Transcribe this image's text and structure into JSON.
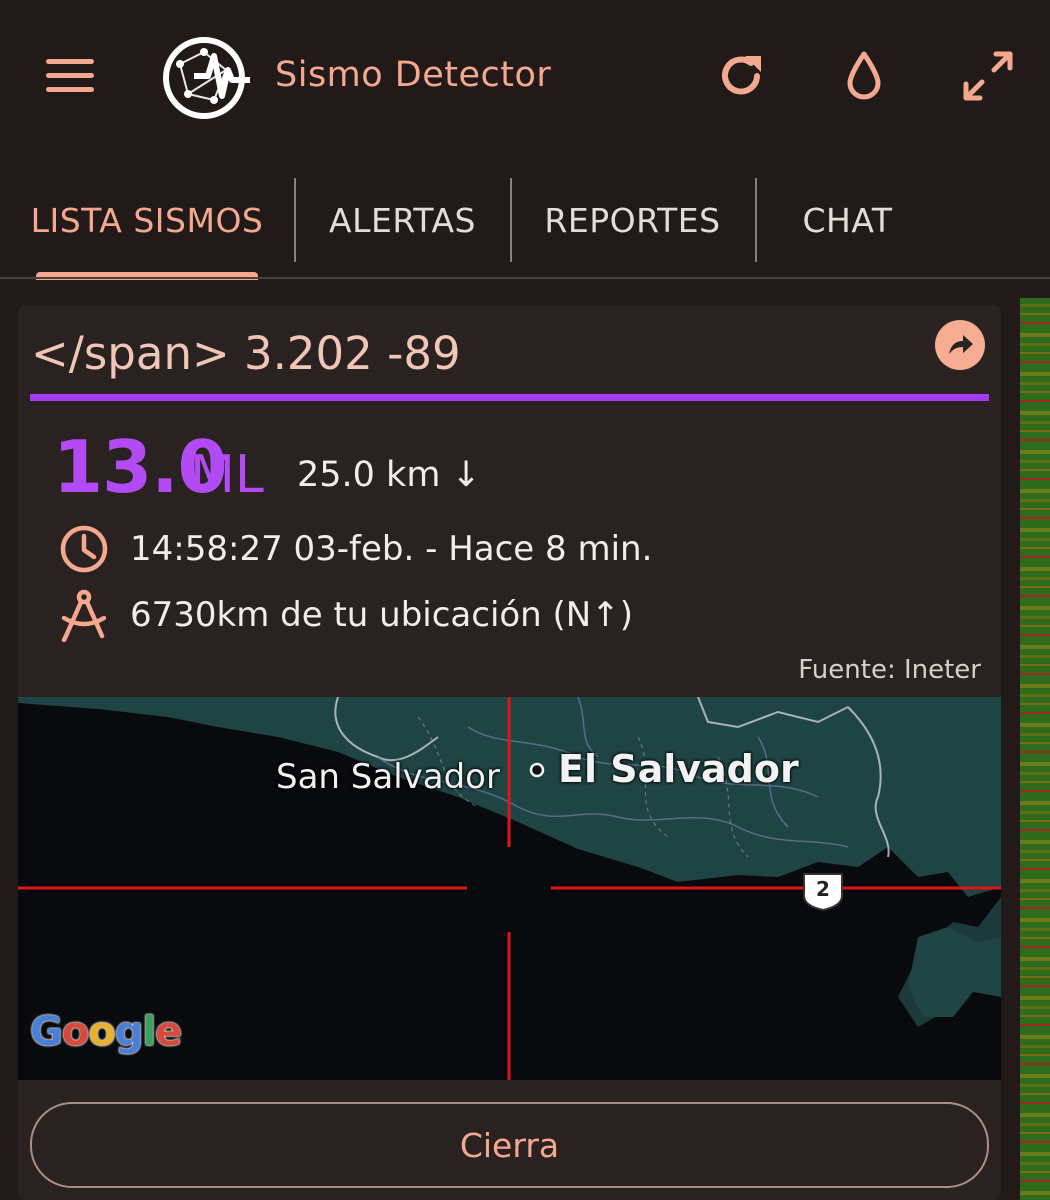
{
  "app": {
    "title": "Sismo Detector"
  },
  "toolbar": {
    "menu_icon": "menu-icon",
    "logo_icon": "seismic-globe-logo",
    "refresh_icon": "refresh-icon",
    "drop_icon": "water-drop-icon",
    "fullscreen_icon": "expand-icon"
  },
  "tabs": [
    {
      "label": "LISTA SISMOS",
      "active": true
    },
    {
      "label": "ALERTAS",
      "active": false
    },
    {
      "label": "REPORTES",
      "active": false
    },
    {
      "label": "CHAT",
      "active": false
    }
  ],
  "quake": {
    "title": "</span> 3.202 -89",
    "magnitude": "13.0",
    "magnitude_unit": "ML",
    "depth": "25.0 km ↓",
    "time": "14:58:27 03-feb. - Hace 8 min.",
    "distance": "6730km de tu ubicación (N↑)",
    "source": "Fuente: Ineter"
  },
  "map": {
    "city_label": "San Salvador",
    "country_label": "El Salvador",
    "route_shield": "2",
    "attribution": "Google"
  },
  "actions": {
    "close_label": "Cierra"
  },
  "colors": {
    "background": "#211a18",
    "card": "#2a2220",
    "accent": "#f3a88f",
    "magnitude": "#b24bf3",
    "crosshair": "#e01515"
  }
}
